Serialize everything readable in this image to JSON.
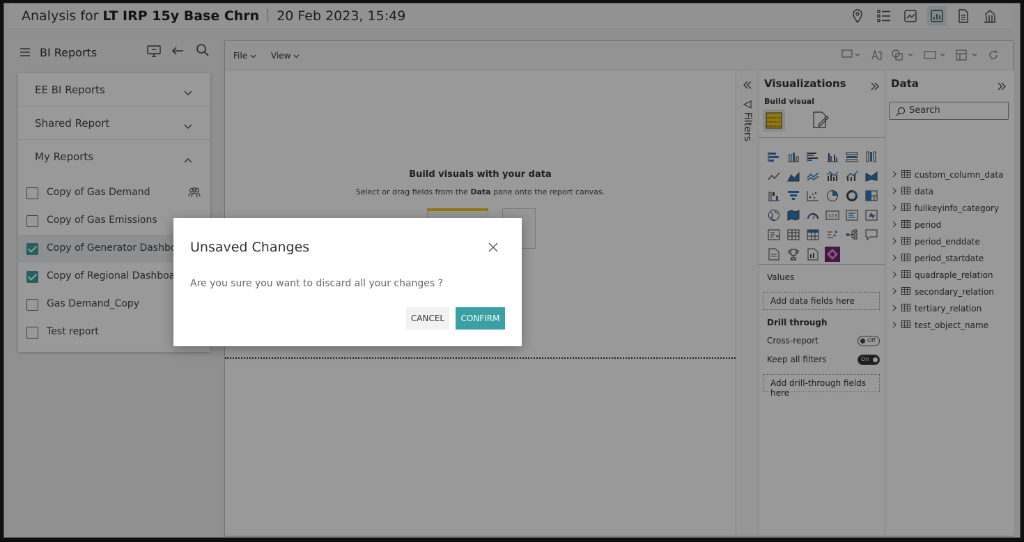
{
  "header": {
    "title_prefix": "Analysis for",
    "title_bold": "LT IRP 15y Base Chrn",
    "timestamp": "20 Feb 2023, 15:49"
  },
  "sidebar": {
    "title": "BI Reports",
    "sections": [
      {
        "label": "EE BI Reports"
      },
      {
        "label": "Shared Report"
      },
      {
        "label": "My Reports"
      }
    ],
    "reports": [
      {
        "label": "Copy of Gas Demand",
        "checked": false
      },
      {
        "label": "Copy of Gas Emissions",
        "checked": false
      },
      {
        "label": "Copy of Generator Dashboa",
        "checked": true
      },
      {
        "label": "Copy of Regional Dashboard",
        "checked": true
      },
      {
        "label": "Gas Demand_Copy",
        "checked": false
      },
      {
        "label": "Test report",
        "checked": false
      }
    ]
  },
  "editor": {
    "menu_file": "File",
    "menu_view": "View",
    "canvas_heading": "Build visuals with your data",
    "canvas_sub_prefix": "Select or drag fields from the",
    "canvas_sub_bold": "Data",
    "canvas_sub_suffix": "pane onto the report canvas.",
    "filters_label": "Filters"
  },
  "visualizations": {
    "title": "Visualizations",
    "build_visual": "Build visual",
    "values_label": "Values",
    "values_drop": "Add data fields here",
    "drill_title": "Drill through",
    "cross_report": "Cross-report",
    "cross_report_state": "Off",
    "keep_filters": "Keep all filters",
    "keep_filters_state": "On",
    "drill_drop": "Add drill-through fields here"
  },
  "data_pane": {
    "title": "Data",
    "search_placeholder": "Search",
    "tables": [
      "custom_column_data",
      "data",
      "fullkeyinfo_category",
      "period",
      "period_enddate",
      "period_startdate",
      "quadraple_relation",
      "secondary_relation",
      "tertiary_relation",
      "test_object_name"
    ]
  },
  "dialog": {
    "title": "Unsaved Changes",
    "message": "Are you sure you want to discard all your changes ?",
    "cancel": "CANCEL",
    "confirm": "CONFIRM"
  },
  "colors": {
    "accent": "#3aa0a3",
    "overlay": "rgba(0,0,0,0.40)"
  }
}
